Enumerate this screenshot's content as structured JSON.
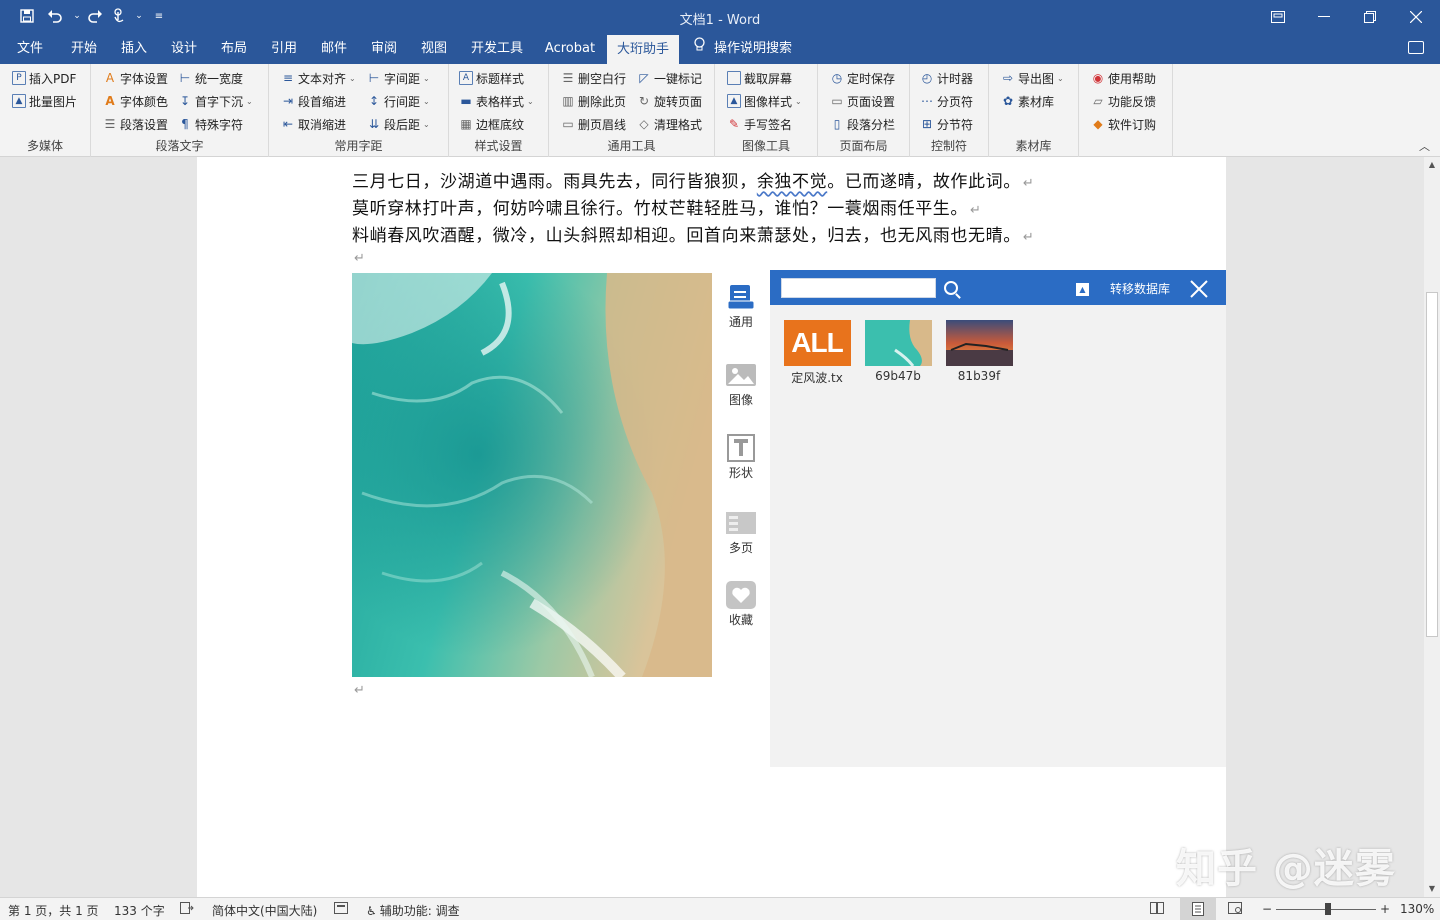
{
  "window": {
    "title": "文档1  -  Word"
  },
  "quick_access": {
    "save": "save-icon",
    "undo": "undo-icon",
    "redo": "redo-icon",
    "touch": "touch-mode-icon"
  },
  "tabs": [
    {
      "label": "文件"
    },
    {
      "label": "开始"
    },
    {
      "label": "插入"
    },
    {
      "label": "设计"
    },
    {
      "label": "布局"
    },
    {
      "label": "引用"
    },
    {
      "label": "邮件"
    },
    {
      "label": "审阅"
    },
    {
      "label": "视图"
    },
    {
      "label": "开发工具"
    },
    {
      "label": "Acrobat"
    },
    {
      "label": "大珩助手"
    }
  ],
  "tell_me": "操作说明搜索",
  "ribbon": {
    "multimedia": {
      "label": "多媒体",
      "items": [
        "插入PDF",
        "批量图片"
      ]
    },
    "para_text": {
      "label": "段落文字",
      "items": [
        "字体设置",
        "字体颜色",
        "段落设置",
        "统一宽度",
        "首字下沉",
        "特殊字符"
      ]
    },
    "spacing": {
      "label": "常用字距",
      "items": [
        "文本对齐",
        "段首缩进",
        "取消缩进",
        "字间距",
        "行间距",
        "段后距"
      ]
    },
    "style": {
      "label": "样式设置",
      "items": [
        "标题样式",
        "表格样式",
        "边框底纹"
      ]
    },
    "general": {
      "label": "通用工具",
      "items": [
        "删空白行",
        "删除此页",
        "删页眉线",
        "一键标记",
        "旋转页面",
        "清理格式"
      ]
    },
    "image": {
      "label": "图像工具",
      "items": [
        "截取屏幕",
        "图像样式",
        "手写签名"
      ]
    },
    "layout": {
      "label": "页面布局",
      "items": [
        "定时保存",
        "页面设置",
        "段落分栏"
      ]
    },
    "control": {
      "label": "控制符",
      "items": [
        "计时器",
        "分页符",
        "分节符"
      ]
    },
    "library": {
      "label": "素材库",
      "items": [
        "导出图",
        "素材库"
      ]
    },
    "help": {
      "items": [
        "使用帮助",
        "功能反馈",
        "软件订购"
      ]
    }
  },
  "document": {
    "lines": [
      {
        "a": "三月七日，沙湖道中遇雨。雨具先去，同行皆狼狈，",
        "b": "余独不觉",
        "c": "。已而遂晴，故作此词。"
      },
      {
        "a": "莫听穿林打叶声，何妨吟啸且徐行。竹杖芒鞋轻胜马，谁怕？一蓑烟雨任平生。"
      },
      {
        "a": "料峭春风吹酒醒，微冷，山头斜照却相迎。回首向来萧瑟处，归去，也无风雨也无晴。"
      }
    ],
    "para_mark": "↵"
  },
  "plugin": {
    "side": [
      {
        "label": "通用",
        "icon": "document-icon"
      },
      {
        "label": "图像",
        "icon": "image-icon"
      },
      {
        "label": "形状",
        "icon": "text-shape-icon"
      },
      {
        "label": "多页",
        "icon": "multipage-icon"
      },
      {
        "label": "收藏",
        "icon": "heart-icon"
      }
    ],
    "search_placeholder": "",
    "transfer_label": "转移数据库",
    "thumbs": [
      {
        "label": "定风波.tx",
        "badge": "ALL"
      },
      {
        "label": "69b47b"
      },
      {
        "label": "81b39f"
      }
    ]
  },
  "status": {
    "page": "第 1 页，共 1 页",
    "words": "133 个字",
    "lang": "简体中文(中国大陆)",
    "accessibility": "辅助功能: 调查",
    "zoom": "130%"
  },
  "watermark": "知乎 @迷雾",
  "colors": {
    "accent": "#2b579a",
    "plugin_blue": "#2b6cc4",
    "badge_orange": "#e8731c"
  }
}
